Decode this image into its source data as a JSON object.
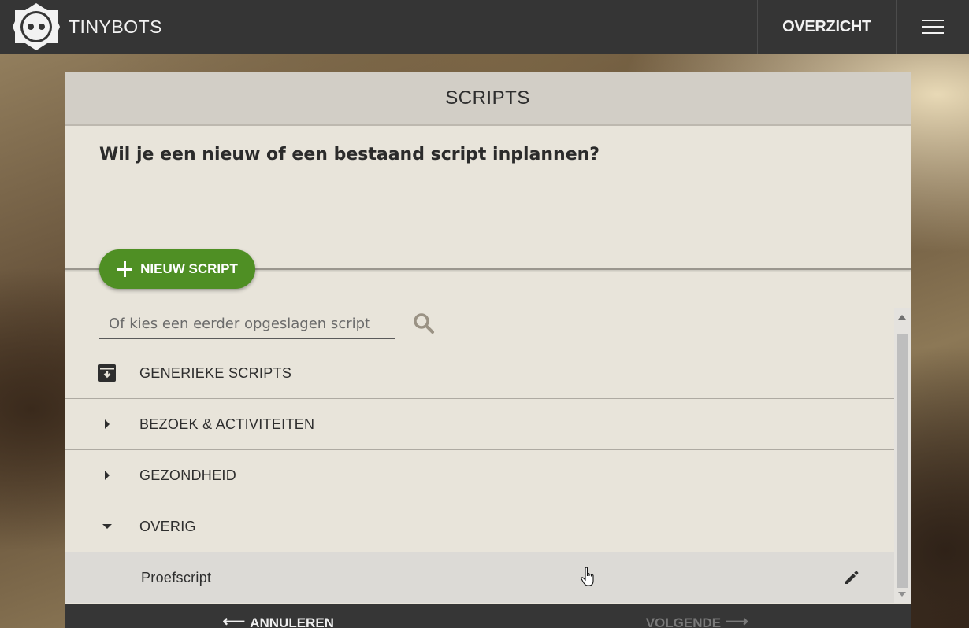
{
  "topbar": {
    "brand": "TINYBOTS",
    "nav_overview": "OVERZICHT"
  },
  "panel": {
    "title": "SCRIPTS",
    "question": "Wil je een nieuw of een bestaand script inplannen?",
    "new_button": "NIEUW SCRIPT",
    "search_placeholder": "Of kies een eerder opgeslagen script",
    "categories": [
      {
        "label": "GENERIEKE SCRIPTS",
        "icon": "archive-icon"
      },
      {
        "label": "BEZOEK & ACTIVITEITEN",
        "icon": "caret-right-icon"
      },
      {
        "label": "GEZONDHEID",
        "icon": "caret-right-icon"
      },
      {
        "label": "OVERIG",
        "icon": "caret-down-icon"
      }
    ],
    "scripts": [
      {
        "label": "Proefscript",
        "icon": "pencil-icon"
      }
    ]
  },
  "footer": {
    "cancel": "ANNULEREN",
    "next": "VOLGENDE"
  },
  "colors": {
    "topbar": "#353535",
    "accent_green": "#4f8f24",
    "panel_bg": "#e8e4da"
  }
}
